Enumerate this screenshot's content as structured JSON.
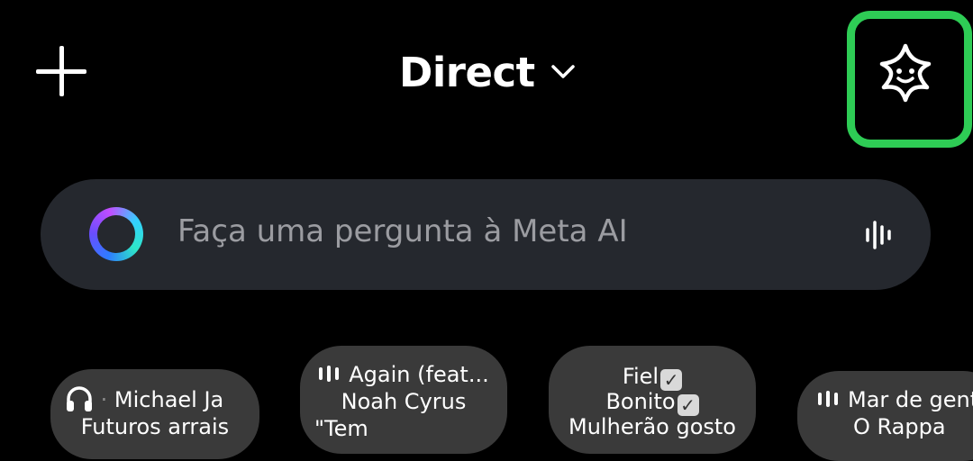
{
  "header": {
    "title": "Direct",
    "new_icon": "plus-icon",
    "dropdown_icon": "chevron-down-icon",
    "ai_icon": "ai-sparkle-face-icon",
    "highlight_color": "#2ecc55"
  },
  "search": {
    "placeholder": "Faça uma pergunta à Meta AI",
    "left_icon": "meta-ai-ring-icon",
    "right_icon": "voice-waveform-icon"
  },
  "notes": [
    {
      "icon": "headphones-icon",
      "line1_prefix": "·",
      "line1": "Michael Ja",
      "line2": "Futuros arrais"
    },
    {
      "icon": "music-bars-icon",
      "line1": "Again (feat...",
      "line2": "Noah Cyrus",
      "line3": "\"Tem"
    },
    {
      "line1": "Fiel",
      "line2": "Bonito",
      "line3": "Mulherão gosto",
      "check_icon": "check-box-icon"
    },
    {
      "icon": "music-bars-icon",
      "line1": "Mar de gent",
      "line2": "O Rappa"
    }
  ]
}
